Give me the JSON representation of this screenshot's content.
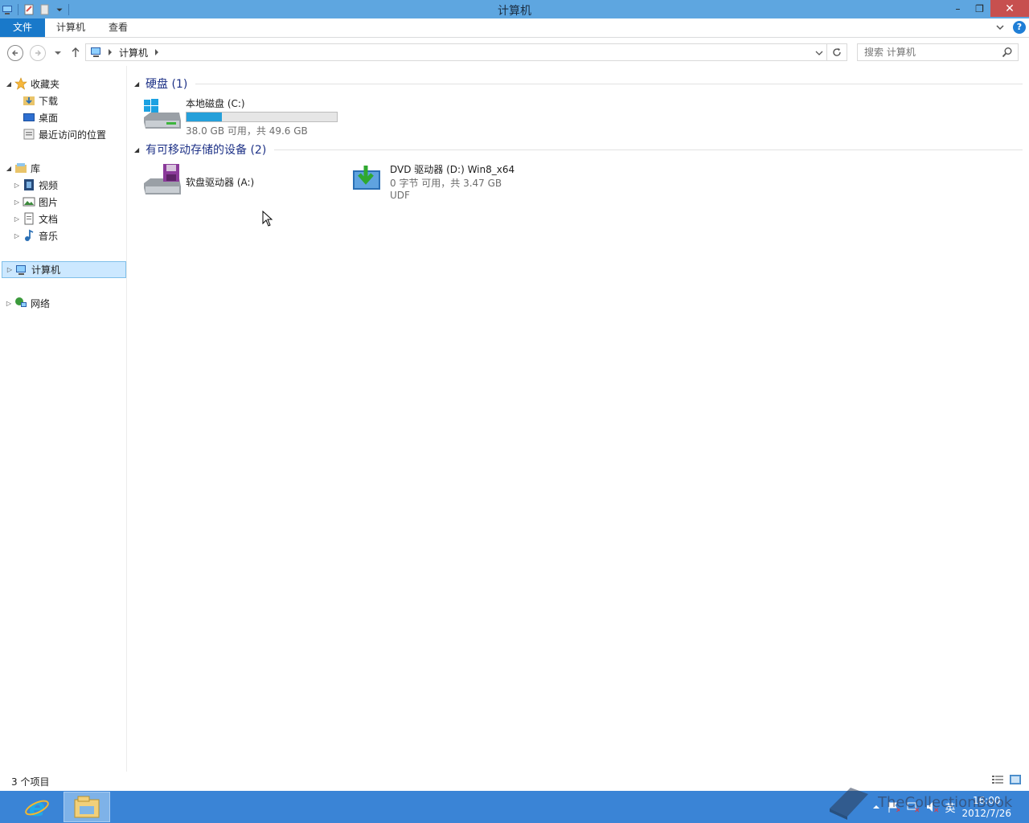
{
  "window": {
    "title": "计算机",
    "minimize": "–",
    "maximize": "❐",
    "close": "✕"
  },
  "ribbon": {
    "tabs": [
      "文件",
      "计算机",
      "查看"
    ],
    "help": "?"
  },
  "address": {
    "path": "计算机",
    "search_placeholder": "搜索 计算机"
  },
  "navpane": {
    "favorites": {
      "label": "收藏夹",
      "items": [
        "下载",
        "桌面",
        "最近访问的位置"
      ]
    },
    "libraries": {
      "label": "库",
      "items": [
        "视频",
        "图片",
        "文档",
        "音乐"
      ]
    },
    "computer": "计算机",
    "network": "网络"
  },
  "groups": [
    {
      "name": "硬盘 (1)",
      "drives": [
        {
          "name": "本地磁盘 (C:)",
          "usage_fraction": 0.234,
          "free_text": "38.0 GB 可用，共 49.6 GB",
          "icon": "windows-hdd-icon"
        }
      ]
    },
    {
      "name": "有可移动存储的设备 (2)",
      "drives": [
        {
          "name": "软盘驱动器 (A:)",
          "icon": "floppy-drive-icon"
        },
        {
          "name": "DVD 驱动器 (D:) Win8_x64",
          "free_text": "0 字节 可用，共 3.47 GB",
          "fs": "UDF",
          "icon": "dvd-drive-icon"
        }
      ]
    }
  ],
  "statusbar": {
    "count": "3 个项目"
  },
  "taskbar": {
    "tray": {
      "ime": "英",
      "time": "16:00",
      "date": "2012/7/26"
    },
    "watermark": "TheCollectionBook"
  },
  "colors": {
    "titlebar": "#5ea6e0",
    "file_tab": "#1979ca",
    "taskbar": "#3a84d6",
    "selection": "#cce8ff",
    "usage_bar": "#26a0da"
  }
}
